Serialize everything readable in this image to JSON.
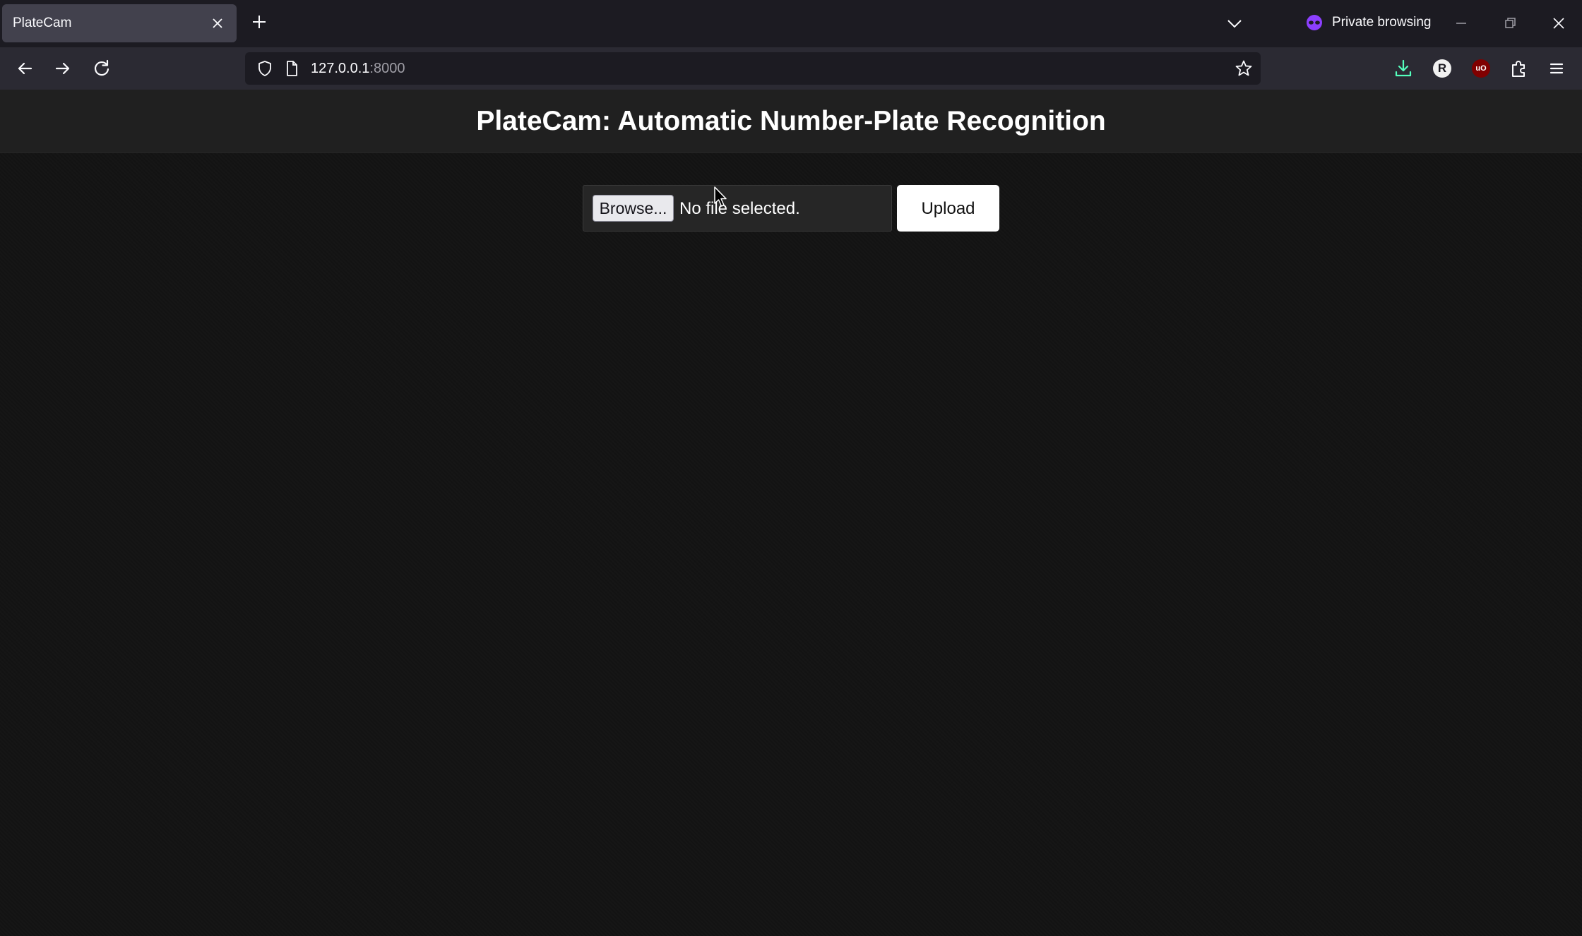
{
  "browser": {
    "tab": {
      "title": "PlateCam"
    },
    "private_label": "Private browsing",
    "url": {
      "host": "127.0.0.1",
      "port": ":8000"
    },
    "icons": {
      "tab_close": "close-icon",
      "new_tab": "plus-icon",
      "tab_list": "chevron-down-icon",
      "private": "private-mask-icon",
      "back": "arrow-left-icon",
      "forward": "arrow-right-icon",
      "reload": "reload-icon",
      "shield": "shield-icon",
      "page": "page-icon",
      "bookmark": "star-icon",
      "downloads": "download-icon",
      "extension_r": "R",
      "extension_ublock": "uO",
      "extensions": "puzzle-icon",
      "menu": "hamburger-menu-icon"
    },
    "colors": {
      "chrome_dark": "#1c1b22",
      "chrome_toolbar": "#2b2a33",
      "tab_active": "#42414d",
      "private_purple": "#8c3fff",
      "download_blue": "#54ffbd"
    }
  },
  "page": {
    "title": "PlateCam: Automatic Number-Plate Recognition",
    "upload": {
      "browse_label": "Browse...",
      "file_status": "No file selected.",
      "upload_label": "Upload"
    },
    "colors": {
      "background": "#131313",
      "header": "#202020",
      "text": "#ffffff"
    }
  }
}
